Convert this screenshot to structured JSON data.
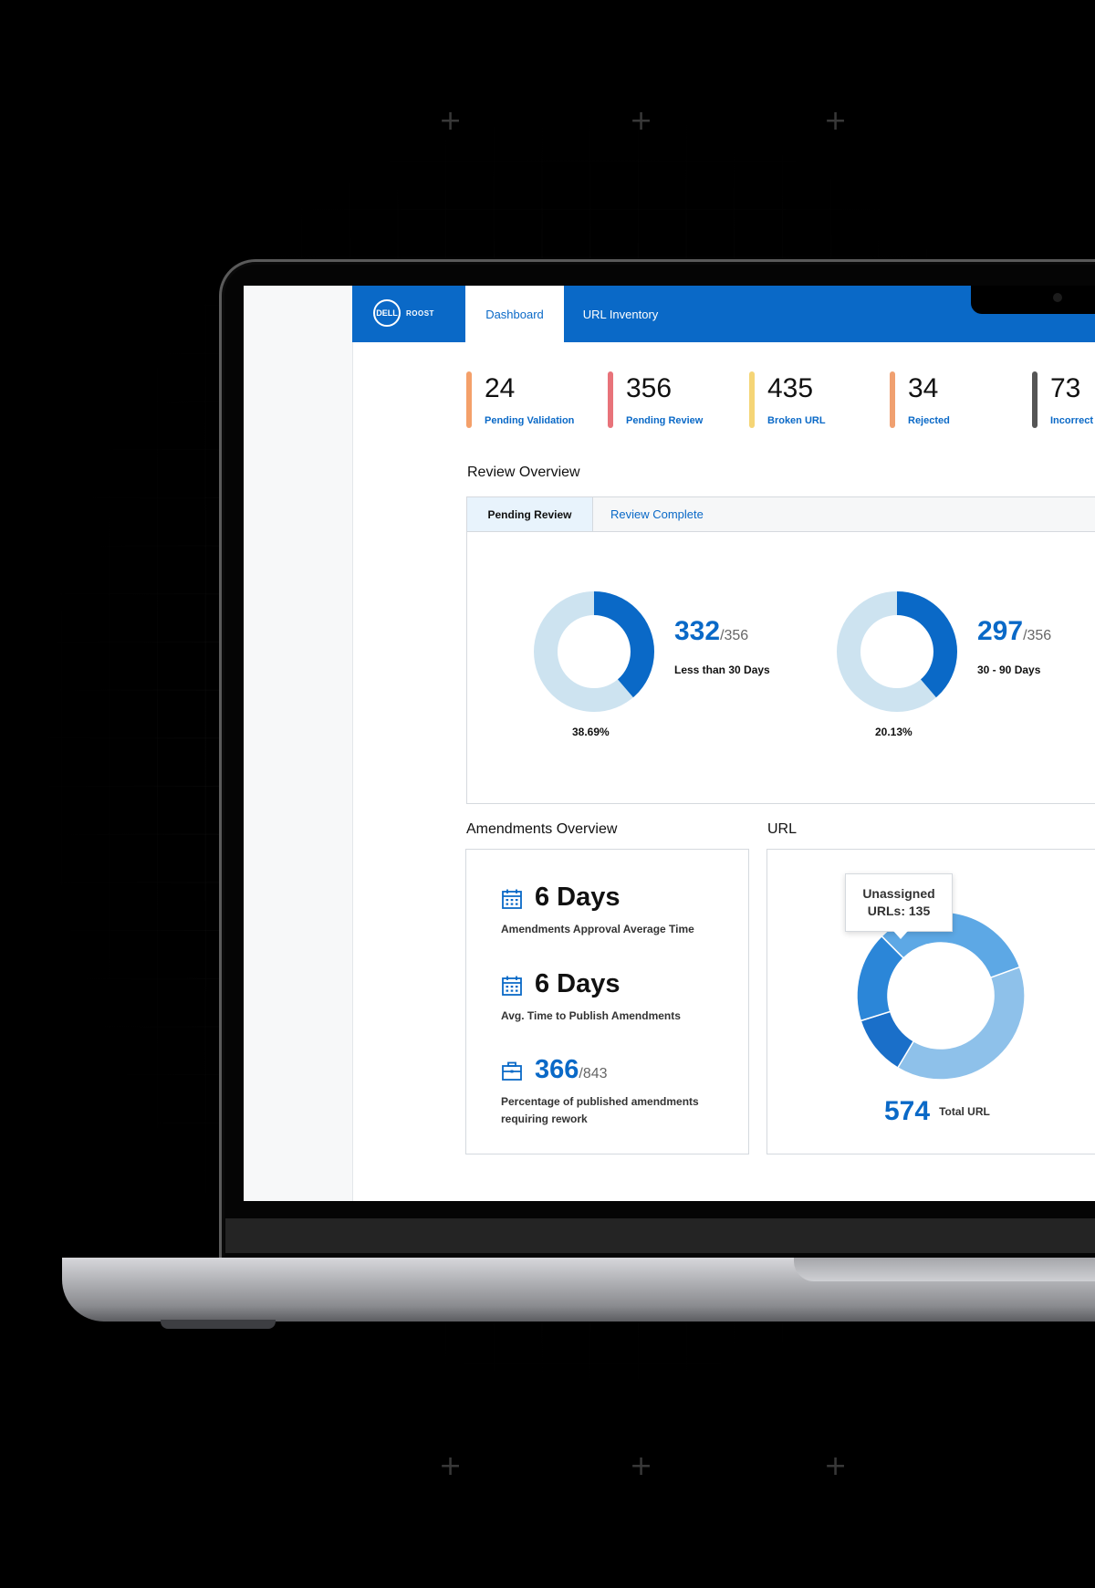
{
  "app": {
    "logo_brand": "DELL",
    "logo_product": "ROOST",
    "tabs": [
      {
        "label": "Dashboard",
        "active": true
      },
      {
        "label": "URL Inventory",
        "active": false
      }
    ],
    "accent_color": "#0a69c7"
  },
  "stats": [
    {
      "value": "24",
      "label": "Pending Validation",
      "color": "#f4a06a"
    },
    {
      "value": "356",
      "label": "Pending Review",
      "color": "#e8737a"
    },
    {
      "value": "435",
      "label": "Broken URL",
      "color": "#f5d576"
    },
    {
      "value": "34",
      "label": "Rejected",
      "color": "#f0a070"
    },
    {
      "value": "73",
      "label": "Incorrect",
      "color": "#555555"
    }
  ],
  "review_overview": {
    "title": "Review Overview",
    "tabs": [
      {
        "label": "Pending Review",
        "active": true
      },
      {
        "label": "Review Complete",
        "active": false
      }
    ],
    "donuts": [
      {
        "value": "332",
        "total": "/356",
        "label": "Less than 30 Days",
        "percent_label": "38.69%",
        "fraction": 0.3869
      },
      {
        "value": "297",
        "total": "/356",
        "label": "30 -  90 Days",
        "percent_label": "20.13%",
        "fraction": 0.3869
      }
    ]
  },
  "amendments_overview": {
    "title": "Amendments Overview",
    "items": [
      {
        "icon": "calendar-icon",
        "value": "6 Days",
        "denominator": "",
        "desc": "Amendments Approval Average Time"
      },
      {
        "icon": "calendar-icon",
        "value": "6 Days",
        "denominator": "",
        "desc": "Avg. Time to Publish Amendments"
      },
      {
        "icon": "briefcase-icon",
        "value": "366",
        "denominator": "/843",
        "desc": "Percentage of published amendments requiring rework"
      }
    ]
  },
  "url_overview": {
    "title": "URL",
    "tooltip_line1": "Unassigned",
    "tooltip_line2": "URLs: 135",
    "total_value": "574",
    "total_label": "Total URL"
  },
  "chart_data": {
    "type": "pie",
    "variant": "donut",
    "title": "URL",
    "slices": [
      {
        "label": "Unassigned URLs",
        "value": 135,
        "color": "#8ec1ea"
      },
      {
        "label": "",
        "value": 40,
        "color": "#1a6fc9"
      },
      {
        "label": "",
        "value": 60,
        "color": "#2b86d8"
      },
      {
        "label": "",
        "value": 110,
        "color": "#5da8e5"
      }
    ],
    "total": 574
  }
}
